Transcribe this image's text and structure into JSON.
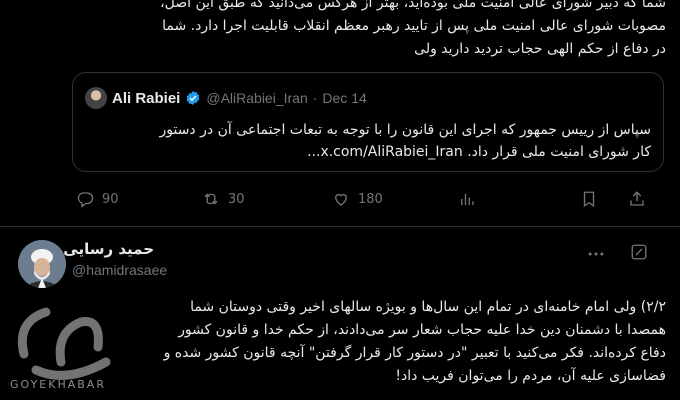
{
  "top_tweet": {
    "lines": [
      "شما که دبیر شورای عالی امنیت ملی بوده‌اید، بهتر از هرکس می‌دانید که طبق این اصل،",
      "مصوبات شورای عالی امنیت ملی پس از تایید رهبر معظم انقلاب قابلیت اجرا دارد. شما",
      "در دفاع از حکم الهی حجاب تردید دارید ولی"
    ]
  },
  "quote": {
    "name": "Ali Rabiei",
    "handle": "@AliRabiei_Iran",
    "separator": "·",
    "date": "Dec 14",
    "lines": [
      "سپاس از رییس جمهور که اجرای این قانون را با توجه به تبعات اجتماعی آن در دستور",
      "کار شورای امنیت ملی قرار داد. x.com/AliRabiei_Iran..."
    ]
  },
  "actions": {
    "replies": "90",
    "reposts": "30",
    "likes": "180"
  },
  "tweet2": {
    "name": "حمید رسایی",
    "handle": "@hamidrasaee",
    "lines": [
      "۲/۲) ولی امام خامنه‌ای در تمام این سال‌ها و بویژه سالهای اخیر وقتی دوستان شما",
      "همصدا با دشمنان دین خدا علیه حجاب شعار سر می‌دادند، از حکم خدا و قانون کشور",
      "دفاع کرده‌اند. فکر می‌کنید با تعبیر \"در دستور کار قرار گرفتن\" آنچه قانون کشور شده و",
      "فضاسازی علیه آن، مردم را می‌توان فریب داد!"
    ]
  },
  "watermark": {
    "text": "GOYEKHABAR"
  },
  "colors": {
    "background": "#000000",
    "text": "#e7e9ea",
    "muted": "#71767b",
    "verified": "#1d9bf0",
    "border": "#2f3336"
  }
}
